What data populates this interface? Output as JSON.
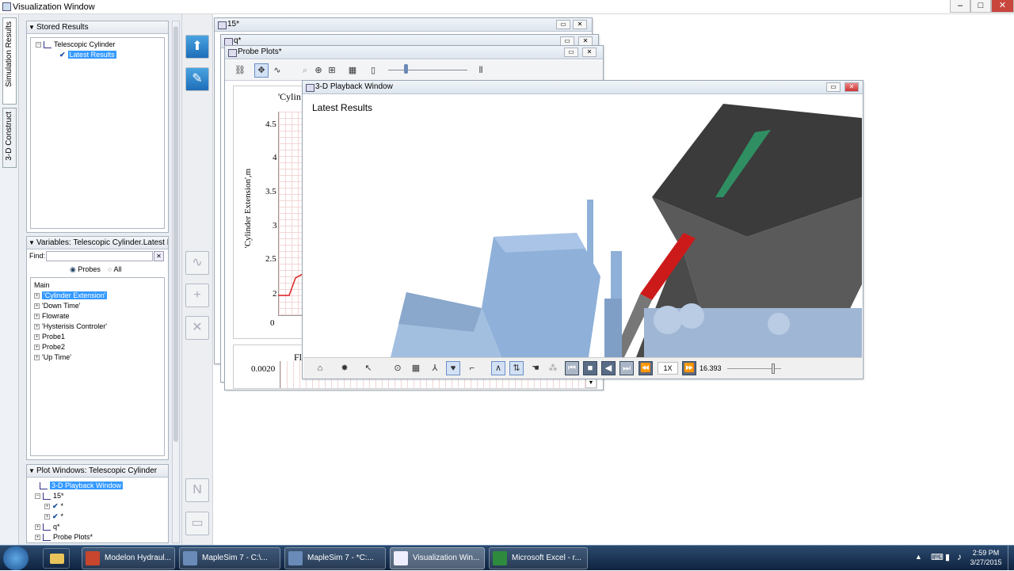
{
  "window": {
    "title": "Visualization Window"
  },
  "vtabs": {
    "simulation": "Simulation Results",
    "construct": "3-D Construct"
  },
  "stored": {
    "header": "Stored Results",
    "model": "Telescopic Cylinder",
    "result": "Latest Results"
  },
  "variables": {
    "header": "Variables: Telescopic Cylinder.Latest Re...",
    "find_label": "Find:",
    "find_value": "",
    "radio_probes": "Probes",
    "radio_all": "All",
    "root": "Main",
    "items": [
      "'Cylinder Extension'",
      "'Down Time'",
      "Flowrate",
      "'Hysterisis Controler'",
      "Probe1",
      "Probe2",
      "'Up Time'"
    ]
  },
  "plotwins": {
    "header": "Plot Windows: Telescopic Cylinder",
    "items": [
      "3-D Playback Window",
      "15*",
      "*",
      "*",
      "q*",
      "Probe Plots*"
    ]
  },
  "windows": {
    "w15": "15*",
    "wq": "q*",
    "probe": "Probe Plots*",
    "playback": "3-D Playback Window"
  },
  "plot": {
    "title": "'Cylin",
    "ylabel": "'Cylinder Extension',m",
    "yticks": [
      "4.5",
      "4",
      "3.5",
      "3",
      "2.5",
      "2",
      "0"
    ],
    "lower_tick": "0.0020",
    "lower_title": "Fl"
  },
  "playback": {
    "scene_label": "Latest Results",
    "speed": "1X",
    "time": "16.393",
    "slider_fraction": 0.88
  },
  "taskbar": {
    "items": [
      "Modelon Hydraul...",
      "MapleSim 7 - C:\\...",
      "MapleSim 7 - *C:...",
      "Visualization Win...",
      "Microsoft Excel - r..."
    ],
    "time": "2:59 PM",
    "date": "3/27/2015"
  }
}
